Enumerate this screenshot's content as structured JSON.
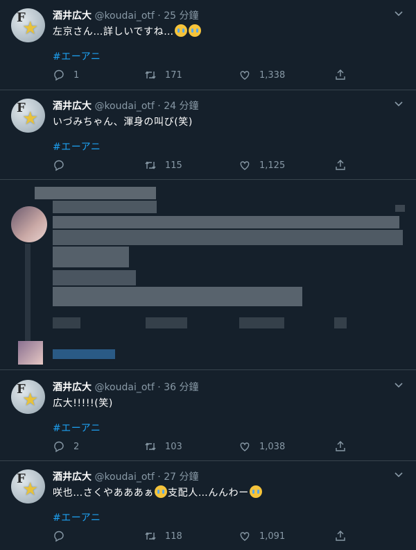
{
  "tweets": [
    {
      "name": "酒井広大",
      "handle": "@koudai_otf",
      "time": "· 25 分鐘",
      "text_before": "左京さん…詳しいですね…",
      "text_after": "",
      "emoji_mid": 2,
      "hashtag": "#エーアニ",
      "replies": "1",
      "retweets": "171",
      "likes": "1,338"
    },
    {
      "name": "酒井広大",
      "handle": "@koudai_otf",
      "time": "· 24 分鐘",
      "text_before": "いづみちゃん、渾身の叫び(笑)",
      "text_after": "",
      "emoji_mid": 0,
      "hashtag": "#エーアニ",
      "replies": "",
      "retweets": "115",
      "likes": "1,125"
    },
    {
      "name": "酒井広大",
      "handle": "@koudai_otf",
      "time": "· 36 分鐘",
      "text_before": "広大!!!!!(笑)",
      "text_after": "",
      "emoji_mid": 0,
      "hashtag": "#エーアニ",
      "replies": "2",
      "retweets": "103",
      "likes": "1,038"
    },
    {
      "name": "酒井広大",
      "handle": "@koudai_otf",
      "time": "· 27 分鐘",
      "text_before": "咲也…さくやあああぁ",
      "text_middle": "支配人…んんわー",
      "text_after": "",
      "hashtag": "#エーアニ",
      "replies": "",
      "retweets": "118",
      "likes": "1,091"
    }
  ],
  "icons": {
    "reply": "reply-icon",
    "retweet": "retweet-icon",
    "like": "heart-icon",
    "share": "share-icon",
    "more": "chevron-down-icon"
  },
  "colors": {
    "background": "#15202b",
    "divider": "#38444d",
    "secondary_text": "#8899a6",
    "link": "#1da1f2"
  }
}
